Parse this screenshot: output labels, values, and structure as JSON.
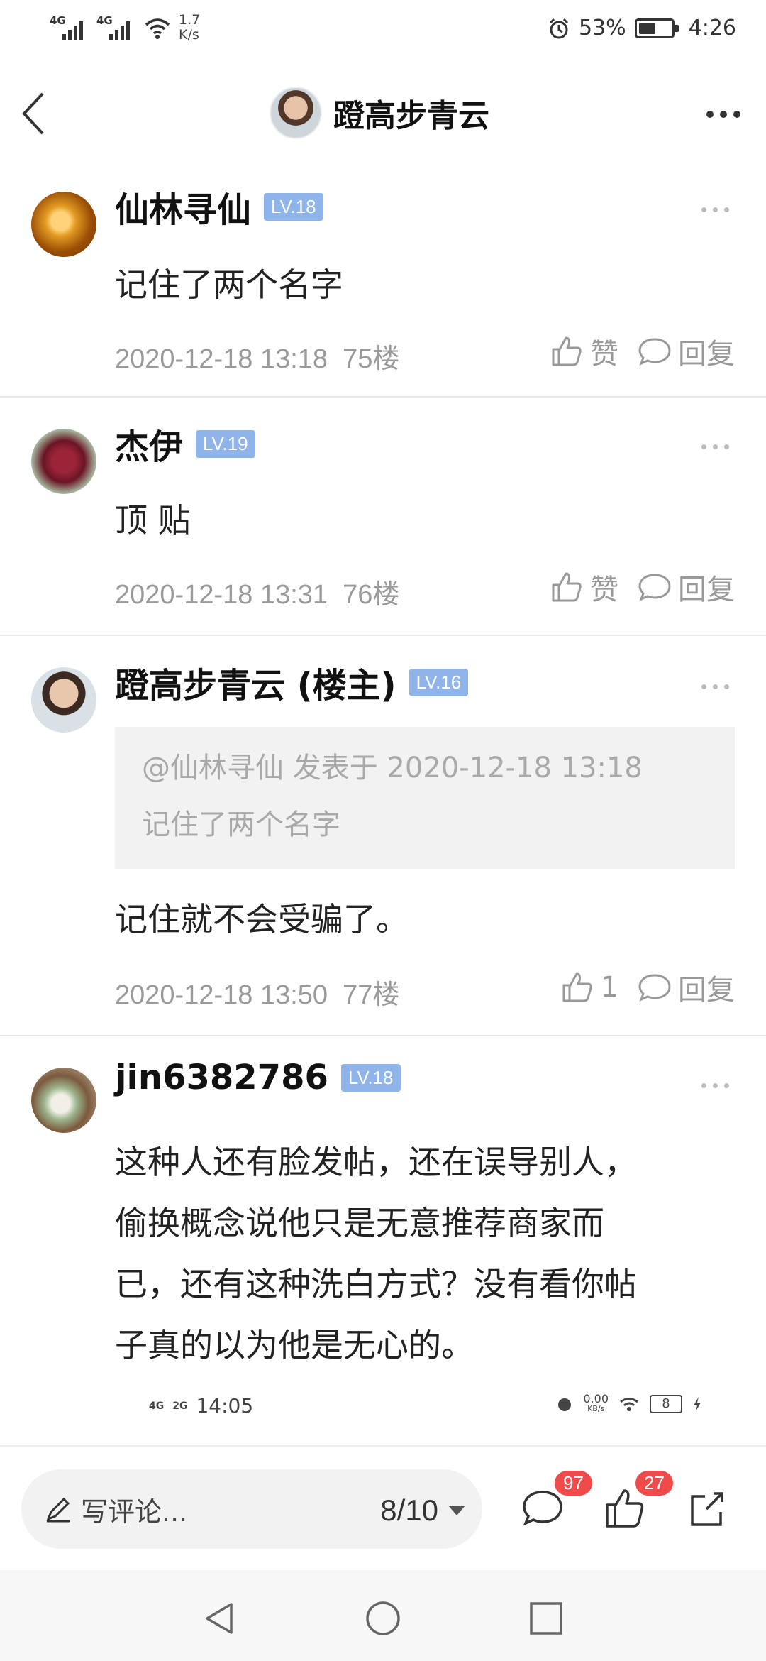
{
  "status_bar": {
    "signal1_tag": "4G",
    "signal2_tag": "4G",
    "speed_value": "1.7",
    "speed_unit": "K/s",
    "battery": "53%",
    "battery_level": 0.53,
    "time": "4:26"
  },
  "header": {
    "title": "蹬高步青云"
  },
  "posts": [
    {
      "username": "仙林寻仙",
      "level": "LV.18",
      "content": "记住了两个名字",
      "timestamp": "2020-12-18 13:18",
      "floor": "75楼",
      "like_label": "赞",
      "reply_label": "回复"
    },
    {
      "username": "杰伊",
      "level": "LV.19",
      "content": "顶 贴",
      "timestamp": "2020-12-18 13:31",
      "floor": "76楼",
      "like_label": "赞",
      "reply_label": "回复"
    },
    {
      "username": "蹬高步青云 (楼主)",
      "level": "LV.16",
      "quote_header": "@仙林寻仙 发表于 2020-12-18 13:18",
      "quote_body": "记住了两个名字",
      "content": "记住就不会受骗了。",
      "timestamp": "2020-12-18 13:50",
      "floor": "77楼",
      "like_label": "1",
      "reply_label": "回复"
    },
    {
      "username": "jin6382786",
      "level": "LV.18",
      "content_lines": [
        "这种人还有脸发帖，还在误导别人，",
        "偷换概念说他只是无意推荐商家而",
        "已，还有这种洗白方式？没有看你帖",
        "子真的以为他是无心的。"
      ],
      "embedded_status": {
        "net1": "4G",
        "net2": "2G",
        "time": "14:05",
        "speed_value": "0.00",
        "speed_unit": "KB/s",
        "battery": "8"
      }
    }
  ],
  "bottom_bar": {
    "comment_placeholder": "写评论...",
    "page_indicator": "8/10",
    "comments_badge": "97",
    "likes_badge": "27"
  }
}
